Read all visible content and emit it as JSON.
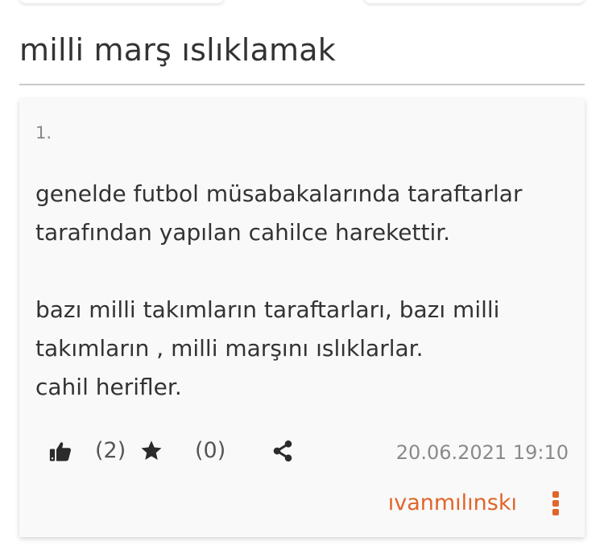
{
  "topic": {
    "title": "milli marş ıslıklamak"
  },
  "entry": {
    "number": "1.",
    "lines": [
      "genelde futbol müsabakalarında taraftarlar",
      "tarafından yapılan cahilce harekettir.",
      "",
      "bazı milli takımların taraftarları, bazı milli",
      "takımların , milli marşını ıslıklarlar.",
      "cahil herifler."
    ],
    "actions": {
      "like_icon": "thumbs-up-icon",
      "like_count": "(2)",
      "favorite_icon": "star-icon",
      "favorite_count": "(0)",
      "share_icon": "share-icon"
    },
    "timestamp": "20.06.2021 19:10",
    "author": "ıvanmılınskı",
    "more_icon": "vertical-dots-icon"
  },
  "colors": {
    "accent": "#e0652b",
    "text": "#333333",
    "muted": "#888888",
    "icon": "#2b2b2b"
  }
}
